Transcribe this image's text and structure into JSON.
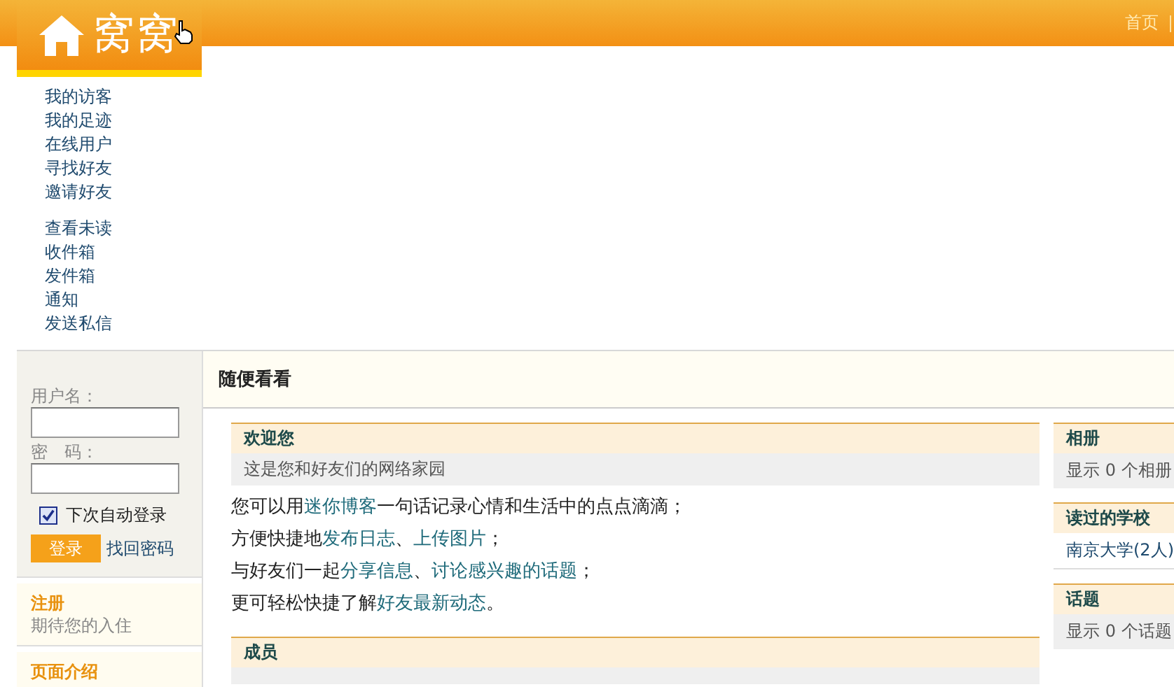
{
  "header": {
    "logo_text": "窝窝",
    "nav": [
      {
        "label": "首页"
      }
    ]
  },
  "menu_groups": [
    {
      "items": [
        {
          "label": "我的访客"
        },
        {
          "label": "我的足迹"
        },
        {
          "label": "在线用户"
        },
        {
          "label": "寻找好友"
        },
        {
          "label": "邀请好友"
        }
      ]
    },
    {
      "items": [
        {
          "label": "查看未读"
        },
        {
          "label": "收件箱"
        },
        {
          "label": "发件箱"
        },
        {
          "label": "通知"
        },
        {
          "label": "发送私信"
        }
      ]
    }
  ],
  "login": {
    "username_label": "用户名：",
    "password_label": "密　码：",
    "remember": {
      "label": "下次自动登录",
      "checked": true
    },
    "login_button": "登录",
    "forgot_link": "找回密码"
  },
  "side_sections": [
    {
      "title": "注册",
      "text": "期待您的入住"
    },
    {
      "title": "页面介绍"
    }
  ],
  "main": {
    "title": "随便看看",
    "welcome": {
      "title": "欢迎您",
      "subtitle": "这是您和好友们的网络家园",
      "lines": [
        [
          {
            "kind": "text",
            "text": "您可以用"
          },
          {
            "kind": "link",
            "text": "迷你博客"
          },
          {
            "kind": "text",
            "text": "一句话记录心情和生活中的点点滴滴；"
          }
        ],
        [
          {
            "kind": "text",
            "text": "方便快捷地"
          },
          {
            "kind": "link",
            "text": "发布日志"
          },
          {
            "kind": "text",
            "text": "、"
          },
          {
            "kind": "link",
            "text": "上传图片"
          },
          {
            "kind": "text",
            "text": "；"
          }
        ],
        [
          {
            "kind": "text",
            "text": "与好友们一起"
          },
          {
            "kind": "link",
            "text": "分享信息"
          },
          {
            "kind": "text",
            "text": "、"
          },
          {
            "kind": "link",
            "text": "讨论感兴趣的话题"
          },
          {
            "kind": "text",
            "text": "；"
          }
        ],
        [
          {
            "kind": "text",
            "text": "更可轻松快捷了解"
          },
          {
            "kind": "link",
            "text": "好友最新动态"
          },
          {
            "kind": "text",
            "text": "。"
          }
        ]
      ]
    },
    "members": {
      "title": "成员"
    },
    "side_boxes": [
      {
        "title": "相册",
        "kind": "text",
        "text": "显示 0 个相册"
      },
      {
        "title": "读过的学校",
        "kind": "link",
        "text": "南京大学(2人)"
      },
      {
        "title": "话题",
        "kind": "text",
        "text": "显示 0 个话题"
      }
    ]
  }
}
